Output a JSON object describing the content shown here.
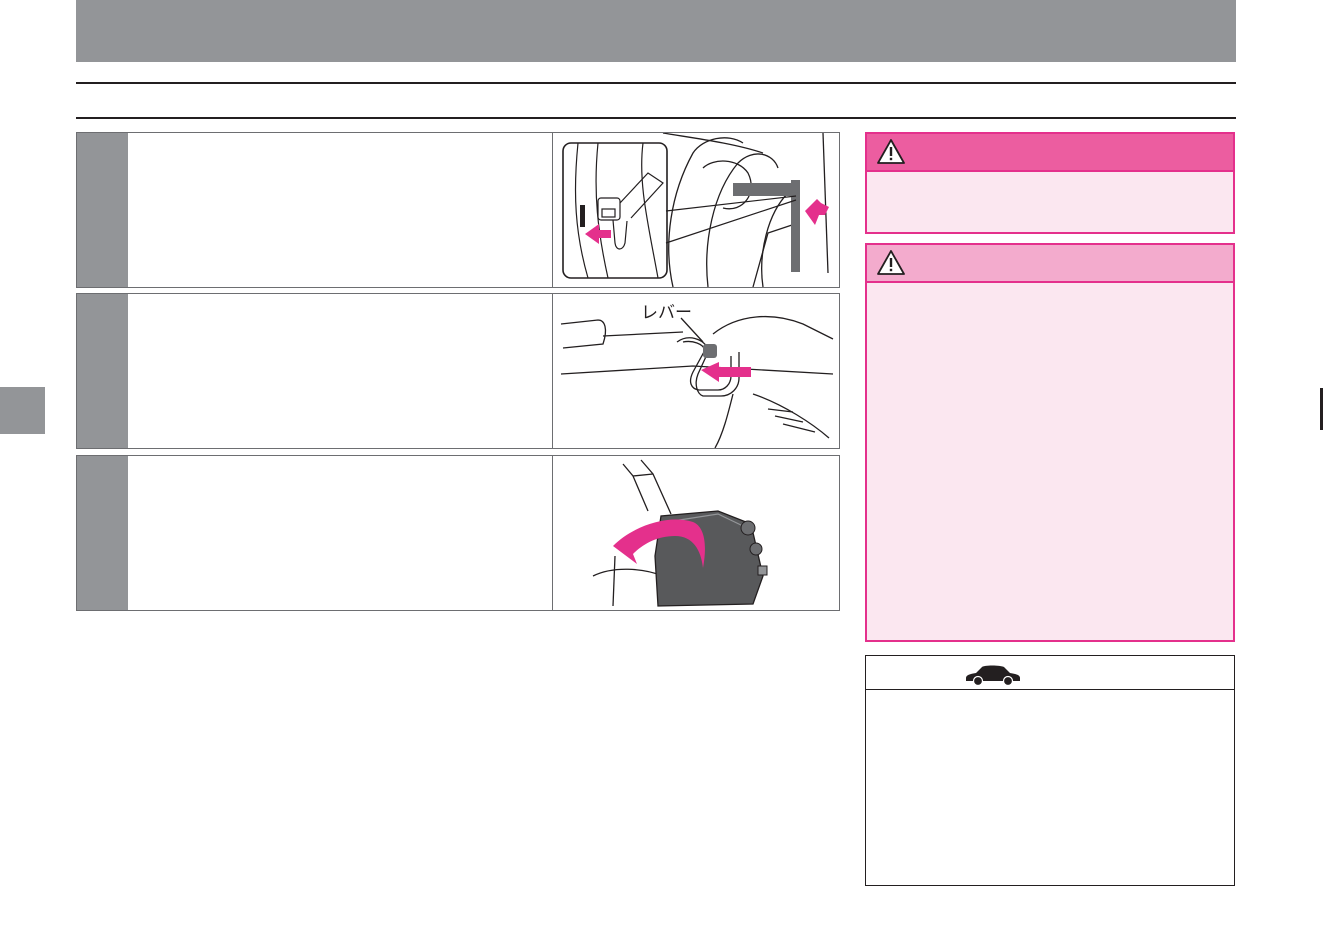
{
  "steps": [
    {
      "number": "",
      "text": "",
      "illustration": "seat-belt-buckle-illustration"
    },
    {
      "number": "",
      "text": "",
      "illustration": "seat-lever-illustration",
      "callout_label": "レバー"
    },
    {
      "number": "",
      "text": "",
      "illustration": "seat-fold-illustration"
    }
  ],
  "warning": {
    "title": "",
    "body": "",
    "icon": "warning-triangle-icon"
  },
  "caution": {
    "title": "",
    "body": "",
    "icon": "warning-triangle-icon"
  },
  "note": {
    "title": "",
    "body": "",
    "icon": "car-icon"
  },
  "colors": {
    "warning_header": "#ec5da0",
    "caution_header": "#f3abcd",
    "box_border": "#e4308c",
    "box_fill": "#fbe7f0",
    "arrow": "#e4308c",
    "gray": "#939598"
  }
}
